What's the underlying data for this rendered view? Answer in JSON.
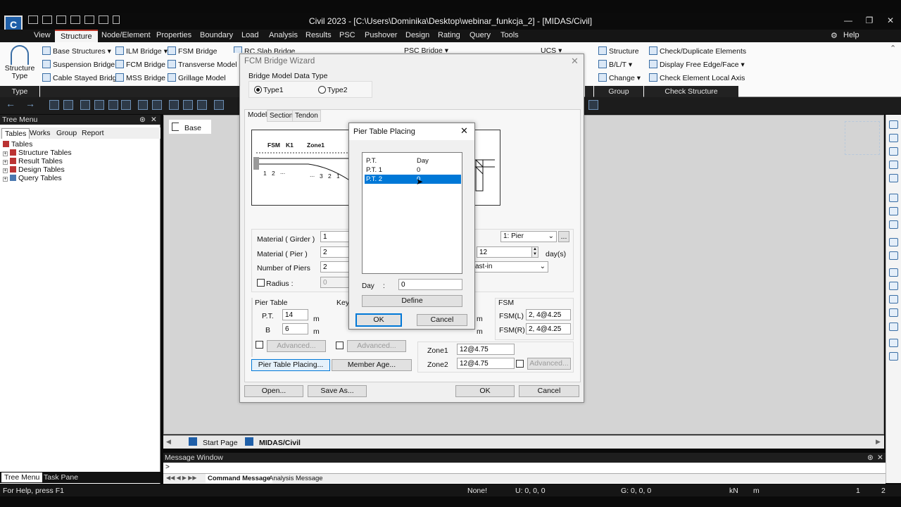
{
  "window": {
    "title": "Civil 2023 - [C:\\Users\\Dominika\\Desktop\\webinar_funkcja_2] - [MIDAS/Civil]"
  },
  "menu": {
    "items": [
      "View",
      "Structure",
      "Node/Element",
      "Properties",
      "Boundary",
      "Load",
      "Analysis",
      "Results",
      "PSC",
      "Pushover",
      "Design",
      "Rating",
      "Query",
      "Tools"
    ],
    "help": "Help"
  },
  "ribbon": {
    "structure_type": "Structure\nType",
    "col1": [
      "Base Structures",
      "Suspension Bridge",
      "Cable Stayed Bridge"
    ],
    "col2": [
      "ILM Bridge",
      "FCM Bridge",
      "MSS Bridge"
    ],
    "col3": [
      "FSM Bridge",
      "Transverse Model",
      "Grillage Model"
    ],
    "col_partial": "RC Slab Bridge",
    "col_partial2": "PSC Bridge",
    "col_partial3": "UCS",
    "group_items": [
      "Structure",
      "B/L/T",
      "Change"
    ],
    "check_items": [
      "Check/Duplicate Elements",
      "Display Free Edge/Face",
      "Check Element Local Axis"
    ],
    "group_labels": {
      "type": "Type",
      "group": "Group",
      "check": "Check Structure"
    }
  },
  "tree": {
    "title": "Tree Menu",
    "tabs": [
      "Tables",
      "Works",
      "Group",
      "Report"
    ],
    "root": "Tables",
    "nodes": [
      "Structure Tables",
      "Result Tables",
      "Design Tables",
      "Query Tables"
    ],
    "bottom_tabs": [
      "Tree Menu",
      "Task Pane"
    ]
  },
  "workspace": {
    "base_label": "Base",
    "doc_tabs": [
      "Start Page",
      "MIDAS/Civil"
    ]
  },
  "message": {
    "title": "Message Window",
    "prompt": ">",
    "tabs": [
      "Command Message",
      "Analysis Message"
    ]
  },
  "status": {
    "help": "For Help, press F1",
    "none": "None!",
    "u": "U: 0, 0, 0",
    "g": "G: 0, 0, 0",
    "unit_force": "kN",
    "unit_len": "m",
    "pages": "1",
    "pages_total": "2"
  },
  "wizard": {
    "title": "FCM Bridge Wizard",
    "data_type_label": "Bridge Model Data Type",
    "type1": "Type1",
    "type2": "Type2",
    "tabs": [
      "Model",
      "Section",
      "Tendon"
    ],
    "diagram_labels": [
      "FSM",
      "K1",
      "Zone1",
      "1",
      "2",
      "...",
      "...",
      "3",
      "2",
      "1"
    ],
    "material_girder_label": "Material ( Girder )",
    "material_girder": "1",
    "material_pier_label": "Material ( Pier )",
    "material_pier": "2",
    "num_piers_label": "Number of Piers",
    "num_piers": "2",
    "radius_label": "Radius :",
    "radius": "0",
    "pier_select": "1: Pier",
    "days_value": "12",
    "days_unit": "day(s)",
    "cast_select": "ast-in",
    "pier_table_label": "Pier Table",
    "pt_label": "P.T.",
    "pt_value": "14",
    "b_label": "B",
    "b_value": "6",
    "m_unit": "m",
    "advanced": "Advanced...",
    "key_seg_label": "Key S",
    "fsm_label": "FSM",
    "fsm_l_label": "FSM(L)",
    "fsm_l": "2, 4@4.25",
    "fsm_r_label": "FSM(R)",
    "fsm_r": "2, 4@4.25",
    "zone1_label": "Zone1",
    "zone1": "12@4.75",
    "zone2_label": "Zone2",
    "zone2": "12@4.75",
    "btn_pier_table": "Pier Table Placing...",
    "btn_member_age": "Member Age...",
    "btn_open": "Open...",
    "btn_save_as": "Save As...",
    "btn_ok": "OK",
    "btn_cancel": "Cancel"
  },
  "pier_dialog": {
    "title": "Pier Table Placing",
    "columns": [
      "P.T.",
      "Day"
    ],
    "rows": [
      {
        "pt": "P.T. 1",
        "day": "0"
      },
      {
        "pt": "P.T. 2",
        "day": "0"
      }
    ],
    "day_label": "Day",
    "day_sep": ":",
    "day_value": "0",
    "define": "Define",
    "ok": "OK",
    "cancel": "Cancel"
  }
}
